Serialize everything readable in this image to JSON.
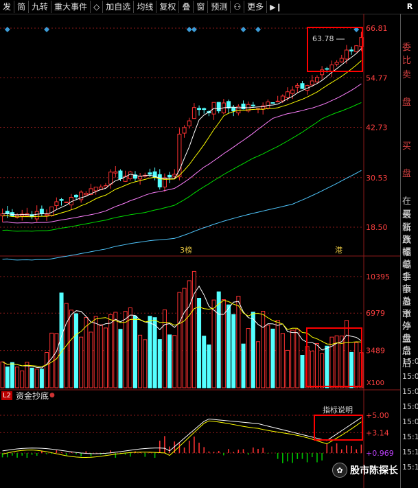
{
  "toolbar": {
    "items": [
      "发",
      "简",
      "九转",
      "重大事件",
      "◇",
      "加自选",
      "均线",
      "复权",
      "叠",
      "窗",
      "预测",
      "⚇",
      "更多"
    ],
    "more_icon": "play-pause-icon",
    "right_label": "R"
  },
  "price_chart": {
    "y_labels": [
      "66.81",
      "54.77",
      "42.73",
      "30.53",
      "18.50"
    ],
    "y_values": [
      66.81,
      54.77,
      42.73,
      30.53,
      18.5
    ],
    "annotation": "63.78",
    "event_labels": [
      "3榜",
      "港"
    ]
  },
  "volume_chart": {
    "y_labels": [
      "10395",
      "6979",
      "3489"
    ],
    "unit": "X100"
  },
  "indicator": {
    "badge": "L2",
    "name": "资金抄底",
    "help": "指标说明",
    "y_labels": [
      "+5.00",
      "+3.14",
      "+0.969"
    ]
  },
  "side_panel": {
    "labels": [
      "委比",
      "卖",
      "盘",
      "买",
      "盘",
      "在买",
      "最新",
      "涨跌",
      "涨幅",
      "振幅",
      "总手",
      "金额",
      "市盈",
      "总市",
      "涨停",
      "外盘",
      "盘后",
      "盘后"
    ],
    "times": [
      "15:0",
      "15:0",
      "15:0",
      "15:0",
      "15:0",
      "15:1",
      "15:1",
      "15:1"
    ]
  },
  "watermark": {
    "text": "股市陈探长"
  },
  "colors": {
    "up": "#ff3232",
    "down": "#54ffff",
    "ma5": "#ffffff",
    "ma10": "#ffff00",
    "ma20": "#ff80ff",
    "ma30": "#00e000",
    "ma60": "#50c8ff",
    "highlight": "#ff0000"
  }
}
